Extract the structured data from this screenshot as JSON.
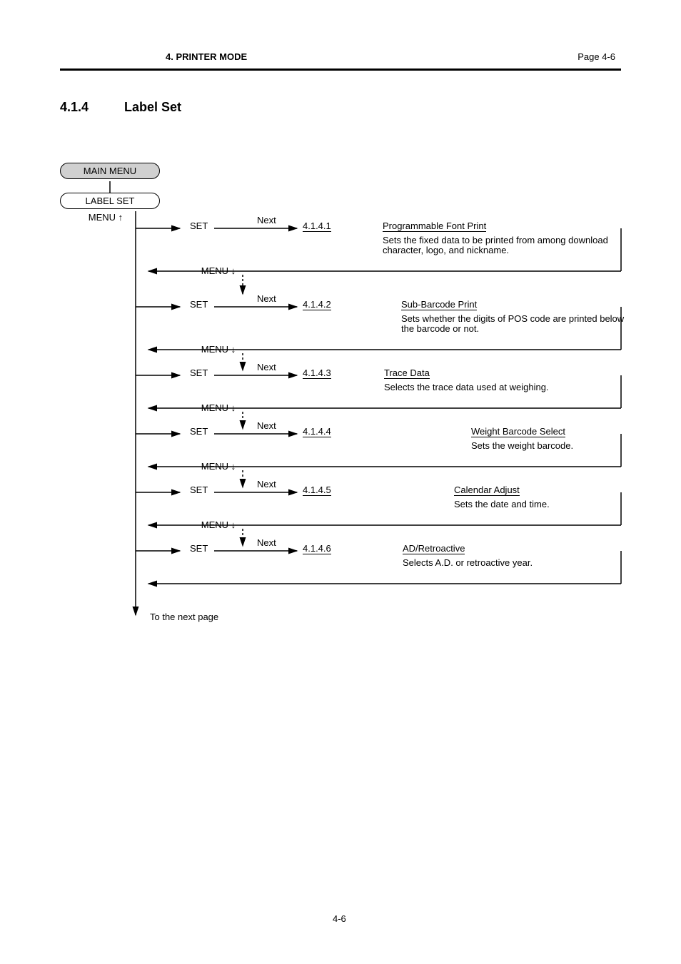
{
  "header": {
    "page_label": "Page 4-6",
    "title": "4. PRINTER MODE"
  },
  "section": {
    "number": "4.1.4",
    "title": "Label Set"
  },
  "pills": {
    "main_menu": "MAIN MENU",
    "label_set": "LABEL SET"
  },
  "nodes": {
    "n1": {
      "menu": "SET",
      "next_link": "4.1.4.1",
      "title": "Programmable Font Print",
      "desc": "Sets the fixed data to be printed from among download\ncharacter, logo, and nickname."
    },
    "n2": {
      "menu": "SET",
      "next_link": "4.1.4.2",
      "title": "Sub-Barcode Print",
      "desc": "Sets whether the digits of POS code are printed below\nthe barcode or not."
    },
    "n3": {
      "menu": "SET",
      "next_link": "4.1.4.3",
      "title": "Trace Data",
      "desc": "Selects the trace data used at weighing."
    },
    "n4": {
      "menu": "SET",
      "next_link": "4.1.4.4",
      "title": "Weight Barcode Select",
      "desc": "Sets the weight barcode."
    },
    "n5": {
      "menu": "SET",
      "next_link": "4.1.4.5",
      "title": "Calendar Adjust",
      "desc": "Sets the date and time."
    },
    "n6": {
      "menu": "SET",
      "next_link": "4.1.4.6",
      "title": "AD/Retroactive",
      "desc": "Selects A.D. or retroactive year."
    }
  },
  "labels": {
    "menu_↑": "MENU\n↑",
    "menu_↓": "MENU\n↓",
    "next": "Next",
    "to_next_page": "To the next page"
  },
  "footer": {
    "page": "4-6"
  }
}
